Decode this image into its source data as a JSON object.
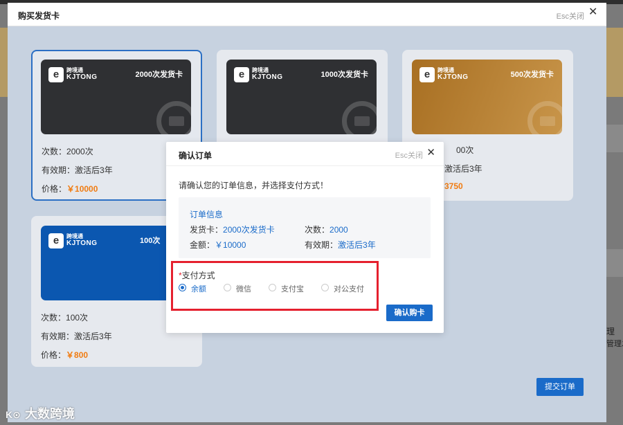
{
  "modal": {
    "title": "购买发货卡",
    "esc_label": "Esc关闭",
    "submit_label": "提交订单"
  },
  "cards": [
    {
      "brand_cn": "跨境通",
      "brand_en": "KJTONG",
      "name": "2000次发货卡",
      "count_label": "次数：",
      "count": "2000次",
      "validity_label": "有效期：",
      "validity": "激活后3年",
      "price_label": "价格：",
      "price": "￥10000",
      "color": "#2f3033",
      "selected": true
    },
    {
      "brand_cn": "跨境通",
      "brand_en": "KJTONG",
      "name": "1000次发货卡",
      "count_label": "",
      "count": "",
      "validity_label": "",
      "validity": "",
      "price_label": "",
      "price": "",
      "color": "#2f3033",
      "selected": false
    },
    {
      "brand_cn": "跨境通",
      "brand_en": "KJTONG",
      "name": "500次发货卡",
      "count_label": "",
      "count": "00次",
      "validity_label": "",
      "validity": "激活后3年",
      "price_label": "",
      "price": "3750",
      "color": "#b07a2c",
      "selected": false
    },
    {
      "brand_cn": "跨境通",
      "brand_en": "KJTONG",
      "name": "100次",
      "count_label": "次数：",
      "count": "100次",
      "validity_label": "有效期：",
      "validity": "激活后3年",
      "price_label": "价格：",
      "price": "￥800",
      "color": "#0b57b0",
      "selected": false
    }
  ],
  "dialog": {
    "title": "确认订单",
    "esc_label": "Esc关闭",
    "prompt": "请确认您的订单信息，并选择支付方式！",
    "order_title": "订单信息",
    "card_label": "发货卡：",
    "card_value": "2000次发货卡",
    "count_label": "次数：",
    "count_value": "2000",
    "amount_label": "金额：",
    "amount_value": "￥10000",
    "validity_label": "有效期：",
    "validity_value": "激活后3年",
    "pay_required": "*",
    "pay_label": "支付方式",
    "pay_options": [
      "余额",
      "微信",
      "支付宝",
      "对公支付"
    ],
    "pay_selected": "余额",
    "confirm_label": "确认购卡"
  },
  "background": {
    "right_text_1": "理",
    "right_text_2": "管理发"
  },
  "watermark": {
    "icon": "K⊙",
    "text": "大数跨境"
  },
  "colors": {
    "accent": "#1a6bc9",
    "price": "#f07c12",
    "highlight": "#e5202e"
  }
}
